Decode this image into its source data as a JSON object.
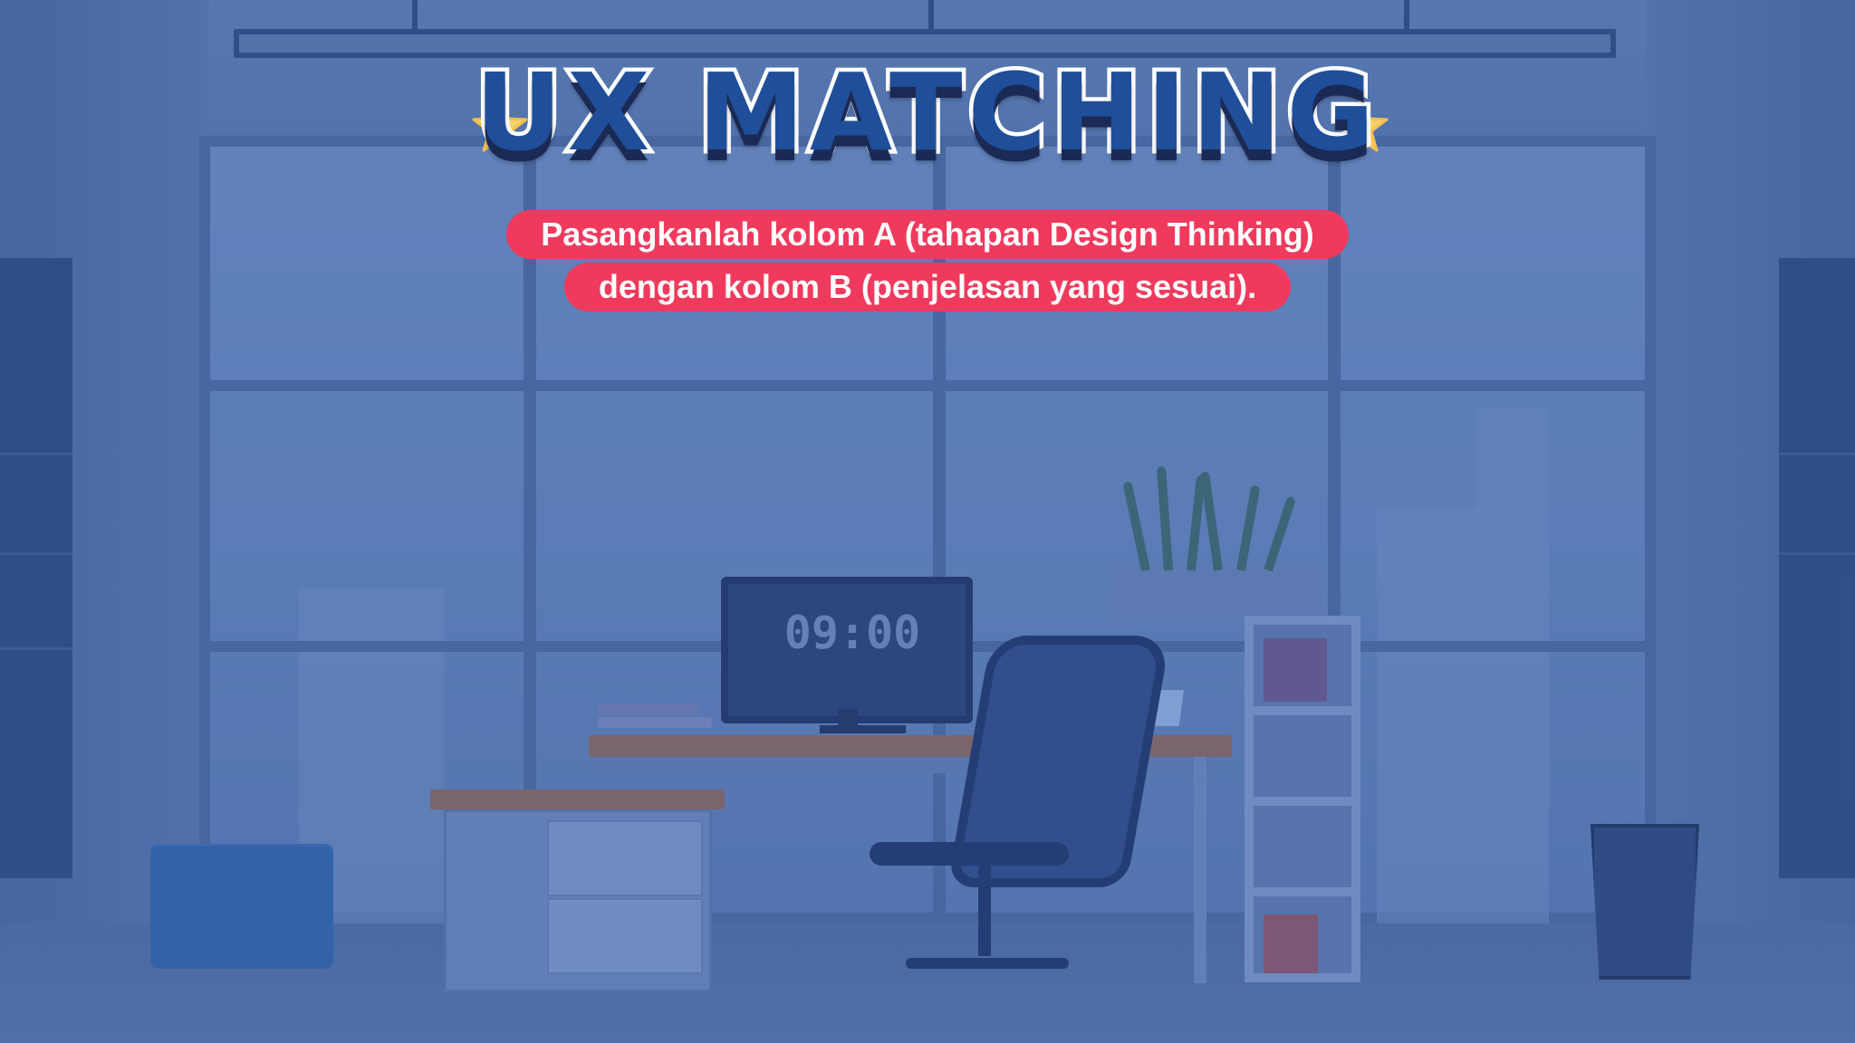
{
  "title": "UX MATCHING",
  "instructions": {
    "line1": "Pasangkanlah kolom A (tahapan Design Thinking)",
    "line2": "dengan  kolom B (penjelasan yang sesuai)."
  },
  "monitor": {
    "clock": "09:00"
  },
  "colors": {
    "title_fill": "#1f4f9a",
    "title_stroke": "#ffffff",
    "pill": "#ef3a5d",
    "star": "#f6d06b",
    "background": "#5a7db6"
  },
  "icons": {
    "left_star": "star-icon",
    "right_star": "star-icon"
  }
}
